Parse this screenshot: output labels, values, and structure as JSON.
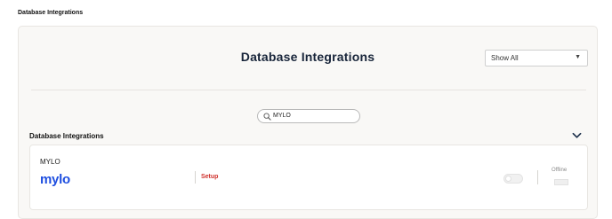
{
  "page": {
    "heading": "Database Integrations"
  },
  "panel": {
    "title": "Database Integrations",
    "filter": {
      "selected": "Show All",
      "caret": "▼"
    },
    "search": {
      "value": "MYLO",
      "icon": "search-icon"
    }
  },
  "section": {
    "title": "Database Integrations",
    "toggle_icon": "chevron-down-icon"
  },
  "integrations": [
    {
      "name": "MYLO",
      "logo_text": "mylo",
      "action_label": "Setup",
      "enabled": false,
      "status": "Offline",
      "colors": {
        "logo": "#1f4fe0",
        "action": "#d0322d"
      }
    }
  ]
}
